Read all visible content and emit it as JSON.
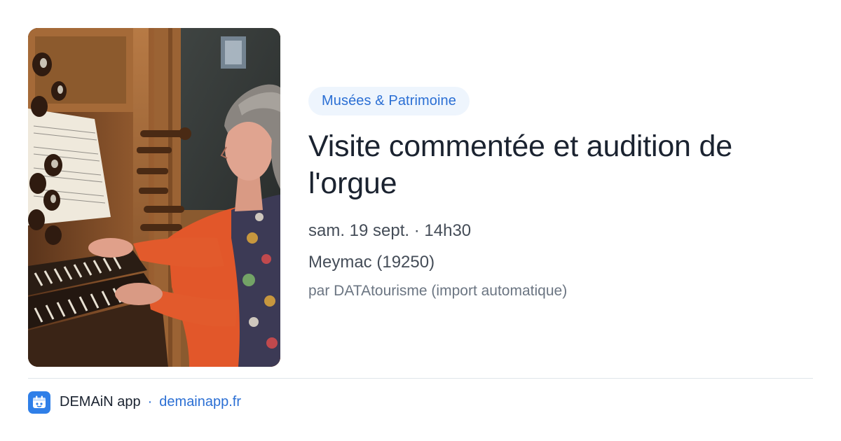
{
  "event": {
    "category": "Musées & Patrimoine",
    "title": "Visite commentée et audition de l'orgue",
    "datetime": "sam. 19 sept. · 14h30",
    "location": "Meymac (19250)",
    "source": "par DATAtourisme (import automatique)",
    "image_subject": "organ-player-photo"
  },
  "footer": {
    "app_name": "DEMAiN app",
    "separator": "·",
    "domain": "demainapp.fr",
    "icon": "app-logo-icon"
  },
  "colors": {
    "accent": "#2b6fd4",
    "tag_background": "#eef5fd",
    "title": "#1b2330",
    "body": "#454d58",
    "muted": "#6b7582",
    "divider": "#dfe5ea"
  }
}
